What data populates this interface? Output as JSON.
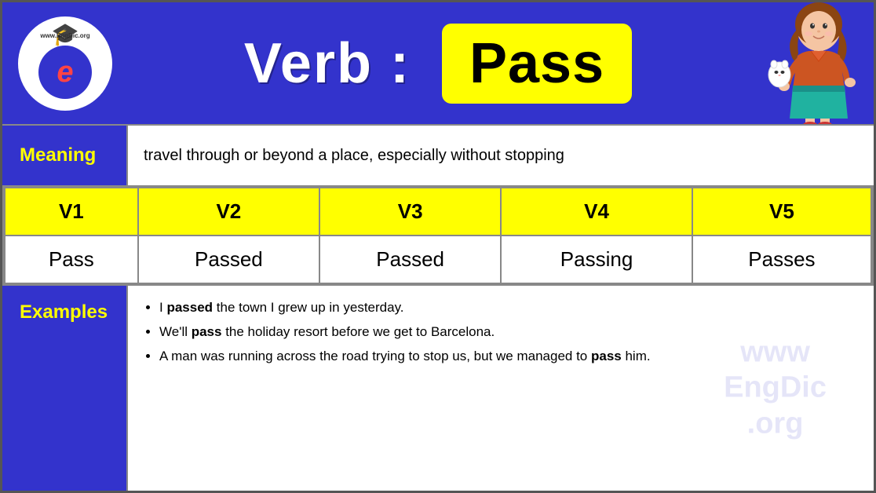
{
  "header": {
    "verb_label": "Verb : ",
    "verb_word": "Pass",
    "logo_text_top": "www.EngDic.org",
    "logo_letter": "e"
  },
  "meaning": {
    "label": "Meaning",
    "text": "travel through or beyond a place, especially without stopping"
  },
  "table": {
    "headers": [
      "V1",
      "V2",
      "V3",
      "V4",
      "V5"
    ],
    "row": [
      "Pass",
      "Passed",
      "Passed",
      "Passing",
      "Passes"
    ]
  },
  "examples": {
    "label": "Examples",
    "items": [
      {
        "before": "I ",
        "bold": "passed",
        "after": " the town I grew up in yesterday."
      },
      {
        "before": "We'll ",
        "bold": "pass",
        "after": " the holiday resort before we get to Barcelona."
      },
      {
        "before": "A man was running across the road trying to stop us, but we managed to ",
        "bold": "pass",
        "after": " him."
      }
    ]
  }
}
